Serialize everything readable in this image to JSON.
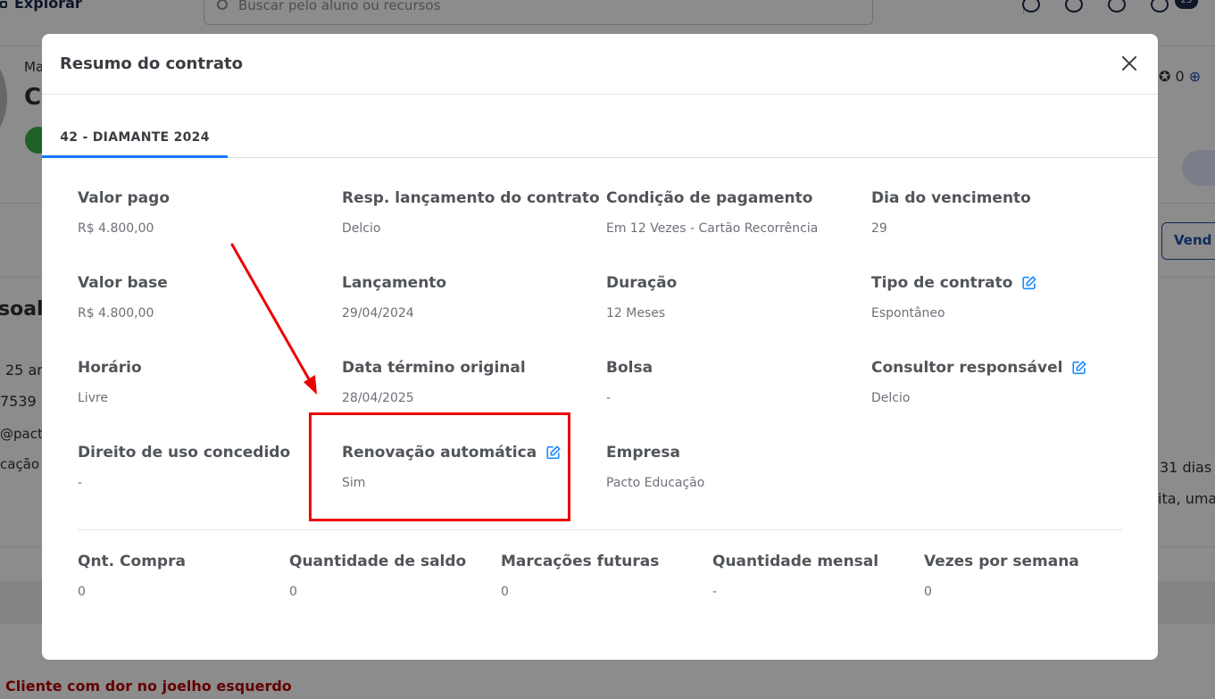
{
  "background": {
    "nav_explorar": "Explorar",
    "search_placeholder": "Buscar pelo aluno ou recursos",
    "notification_count": "25",
    "frag_ma": "Ma",
    "frag_c": "C",
    "frag_soal": "soal",
    "frag_25": "25 an",
    "frag_7539": "7539",
    "frag_pact": "@pact",
    "frag_cacao": "cação",
    "frag_score": "0",
    "frag_vend": "Vend",
    "frag_31dias": "31 dias",
    "frag_ita": "ita, uma",
    "alert_text": "Cliente com dor no joelho esquerdo"
  },
  "modal": {
    "title": "Resumo do contrato",
    "tab_label": "42 - DIAMANTE 2024",
    "fields": {
      "valor_pago": {
        "label": "Valor pago",
        "value": "R$ 4.800,00"
      },
      "resp_lancamento": {
        "label": "Resp. lançamento do contrato",
        "value": "Delcio"
      },
      "condicao_pagamento": {
        "label": "Condição de pagamento",
        "value": "Em 12 Vezes - Cartão Recorrência"
      },
      "dia_vencimento": {
        "label": "Dia do vencimento",
        "value": "29"
      },
      "valor_base": {
        "label": "Valor base",
        "value": "R$ 4.800,00"
      },
      "lancamento": {
        "label": "Lançamento",
        "value": "29/04/2024"
      },
      "duracao": {
        "label": "Duração",
        "value": "12 Meses"
      },
      "tipo_contrato": {
        "label": "Tipo de contrato",
        "value": "Espontâneo"
      },
      "horario": {
        "label": "Horário",
        "value": "Livre"
      },
      "data_termino": {
        "label": "Data término original",
        "value": "28/04/2025"
      },
      "bolsa": {
        "label": "Bolsa",
        "value": "-"
      },
      "consultor": {
        "label": "Consultor responsável",
        "value": "Delcio"
      },
      "direito_uso": {
        "label": "Direito de uso concedido",
        "value": "-"
      },
      "renovacao": {
        "label": "Renovação automática",
        "value": "Sim"
      },
      "empresa": {
        "label": "Empresa",
        "value": "Pacto Educação"
      }
    },
    "summary": {
      "qnt_compra": {
        "label": "Qnt. Compra",
        "value": "0"
      },
      "qtd_saldo": {
        "label": "Quantidade de saldo",
        "value": "0"
      },
      "marcacoes": {
        "label": "Marcações futuras",
        "value": "0"
      },
      "qtd_mensal": {
        "label": "Quantidade mensal",
        "value": "-"
      },
      "vezes_semana": {
        "label": "Vezes por semana",
        "value": "0"
      }
    }
  },
  "colors": {
    "accent": "#1677ff",
    "annotation_red": "#ee0000",
    "edit_icon": "#1a8cff"
  }
}
